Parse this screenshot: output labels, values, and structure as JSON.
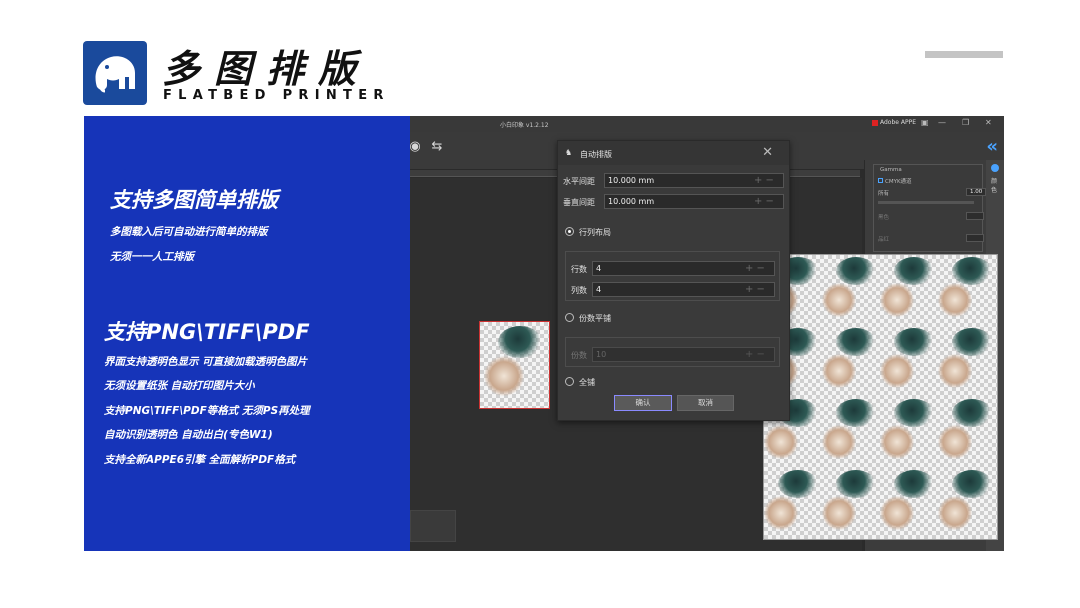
{
  "header": {
    "title_cn": "多图排版",
    "title_en": "FLATBED PRINTER",
    "logo_icon": "elephant-logo-icon"
  },
  "features": {
    "section1": {
      "heading": "支持多图简单排版",
      "lines": [
        "多图载入后可自动进行简单的排版",
        "无须一一人工排版"
      ]
    },
    "section2": {
      "heading": "支持PNG\\TIFF\\PDF",
      "lines": [
        "界面支持透明色显示  可直接加载透明色图片",
        "无须设置纸张  自动打印图片大小",
        "支持PNG\\TIFF\\PDF等格式  无须PS再处理",
        "自动识别透明色    自动出白(专色W1)",
        "支持全新APPE6引擎  全面解析PDF格式"
      ]
    }
  },
  "app": {
    "window_title": "小白印象 v1.2.12",
    "product_label": "Adobe APPE",
    "props": {
      "section_title": "Gamma",
      "cmyk_checkbox": "CMYK通道",
      "all_label": "所有",
      "all_value": "1.00",
      "dim_label_1": "黑色",
      "dim_label_2": "品红",
      "side_tab": "颜色"
    }
  },
  "dialog": {
    "title": "自动排版",
    "h_spacing_label": "水平间距",
    "h_spacing_value": "10.000 mm",
    "v_spacing_label": "垂直间距",
    "v_spacing_value": "10.000 mm",
    "option_rowcol": "行列布局",
    "rows_label": "行数",
    "rows_value": "4",
    "cols_label": "列数",
    "cols_value": "4",
    "option_copies": "份数平铺",
    "copies_label": "份数",
    "copies_value": "10",
    "option_full": "全铺",
    "confirm": "确认",
    "cancel": "取消",
    "selected_option": "行列布局"
  },
  "colors": {
    "brand_blue": "#1634b9",
    "logo_blue": "#1a4a9c",
    "app_bg": "#2b2b2b",
    "accent": "#4aa3ff"
  }
}
